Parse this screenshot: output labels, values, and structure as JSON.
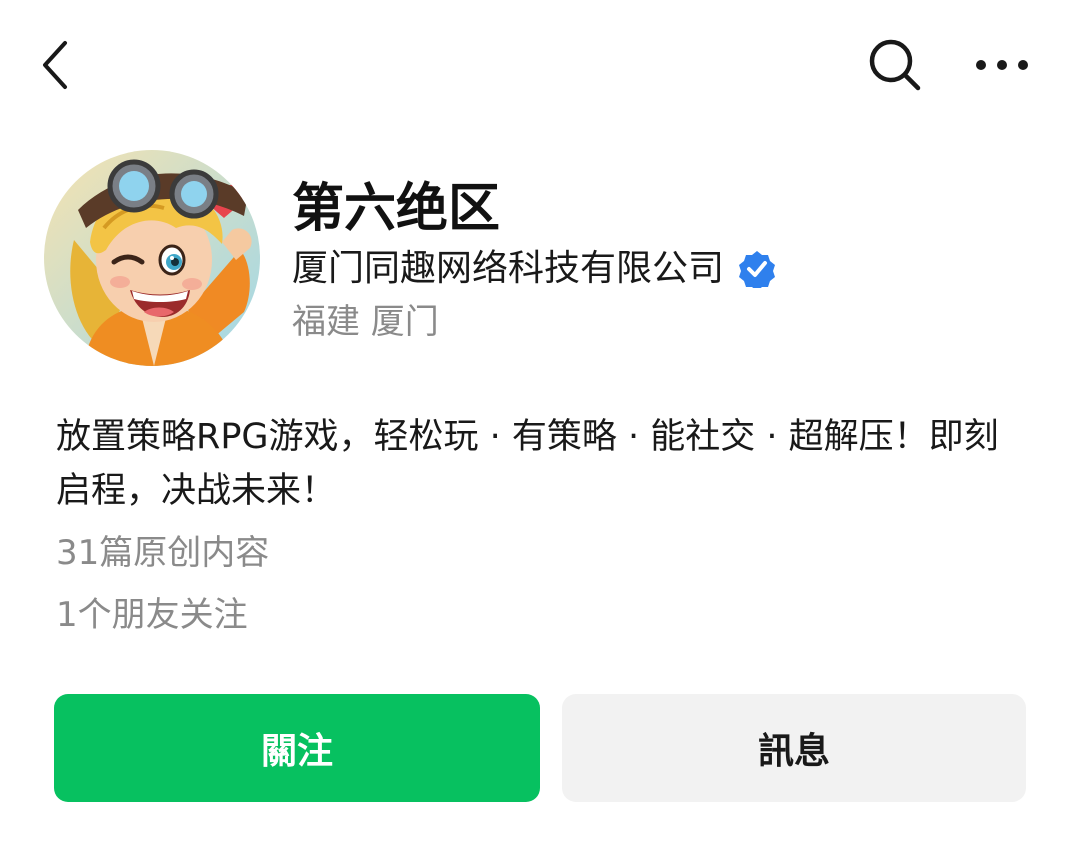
{
  "nav": {
    "back_icon": "chevron-left-icon",
    "search_icon": "search-icon",
    "more_icon": "more-horizontal-icon"
  },
  "profile": {
    "name": "第六绝区",
    "company": "厦门同趣网络科技有限公司",
    "verified_icon": "verified-check-icon",
    "location": "福建 厦门",
    "description": "放置策略RPG游戏，轻松玩 · 有策略 · 能社交 · 超解压！即刻启程，决战未来！",
    "original_count": "31篇原创内容",
    "friends_following": "1个朋友关注"
  },
  "actions": {
    "follow_label": "關注",
    "message_label": "訊息"
  },
  "colors": {
    "accent_green": "#07c160",
    "verified_blue": "#2f80ed",
    "secondary_text": "#8a8a8a",
    "message_button_bg": "#f2f2f2"
  }
}
